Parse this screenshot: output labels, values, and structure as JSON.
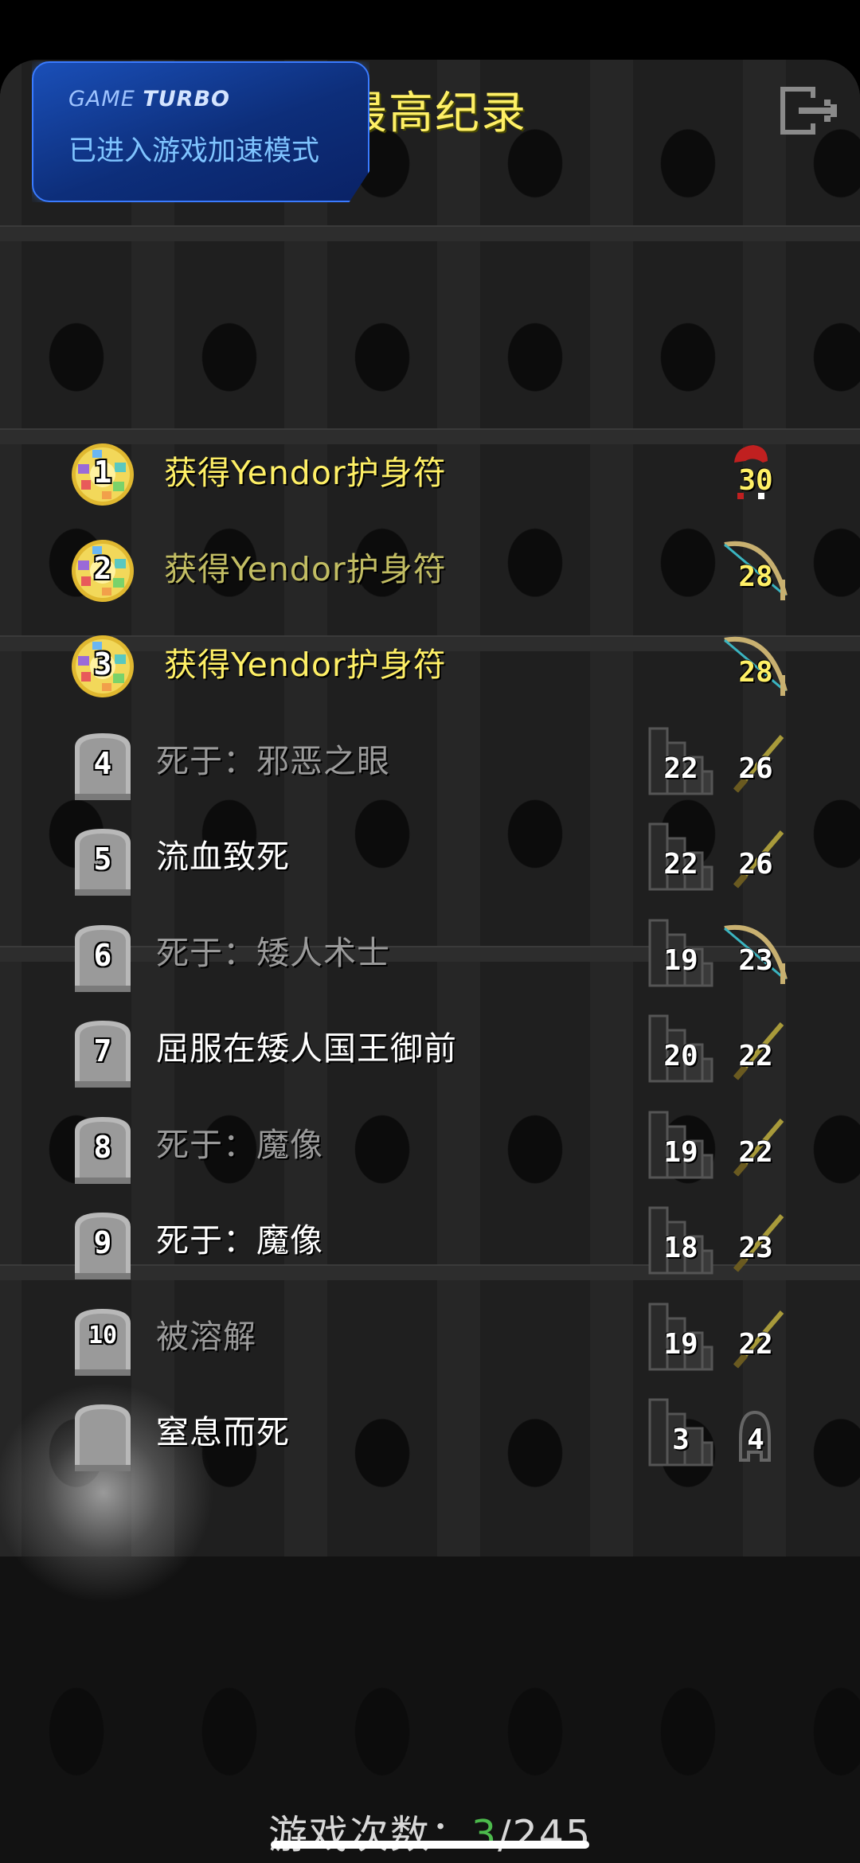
{
  "header": {
    "title": "最高纪录"
  },
  "overlay": {
    "brand_prefix": "GAME",
    "brand_suffix": "TURBO",
    "message": "已进入游戏加速模式"
  },
  "records": [
    {
      "rank": "1",
      "label": "获得Yendor护身符",
      "depth": "",
      "level": "30",
      "type": "win",
      "label_color": "#fff066"
    },
    {
      "rank": "2",
      "label": "获得Yendor护身符",
      "depth": "",
      "level": "28",
      "type": "win",
      "label_color": "#c2bd63"
    },
    {
      "rank": "3",
      "label": "获得Yendor护身符",
      "depth": "",
      "level": "28",
      "type": "win",
      "label_color": "#fff066"
    },
    {
      "rank": "4",
      "label": "死于：邪恶之眼",
      "depth": "22",
      "level": "26",
      "type": "death",
      "label_color": "#9a9a9a"
    },
    {
      "rank": "5",
      "label": "流血致死",
      "depth": "22",
      "level": "26",
      "type": "death",
      "label_color": "#ffffff"
    },
    {
      "rank": "6",
      "label": "死于：矮人术士",
      "depth": "19",
      "level": "23",
      "type": "death",
      "label_color": "#9a9a9a"
    },
    {
      "rank": "7",
      "label": "屈服在矮人国王御前",
      "depth": "20",
      "level": "22",
      "type": "death",
      "label_color": "#ffffff"
    },
    {
      "rank": "8",
      "label": "死于：魔像",
      "depth": "19",
      "level": "22",
      "type": "death",
      "label_color": "#9a9a9a"
    },
    {
      "rank": "9",
      "label": "死于：魔像",
      "depth": "18",
      "level": "23",
      "type": "death",
      "label_color": "#ffffff"
    },
    {
      "rank": "10",
      "label": "被溶解",
      "depth": "19",
      "level": "22",
      "type": "death",
      "label_color": "#9a9a9a"
    },
    {
      "rank": "",
      "label": "窒息而死",
      "depth": "3",
      "level": "4",
      "type": "latest",
      "label_color": "#ffffff"
    }
  ],
  "footer": {
    "games_label": "游戏次数：",
    "games_current": "3",
    "games_total": "/245"
  },
  "colors": {
    "title": "#fff066",
    "games_current": "#4cba4c",
    "turbo_blue": "#1a4fb8"
  },
  "icons": [
    "exit-icon",
    "amulet-badge-icon",
    "tombstone-badge-icon",
    "depth-stairs-icon",
    "sword-icon",
    "bow-icon",
    "helmet-icon",
    "ankh-icon"
  ]
}
